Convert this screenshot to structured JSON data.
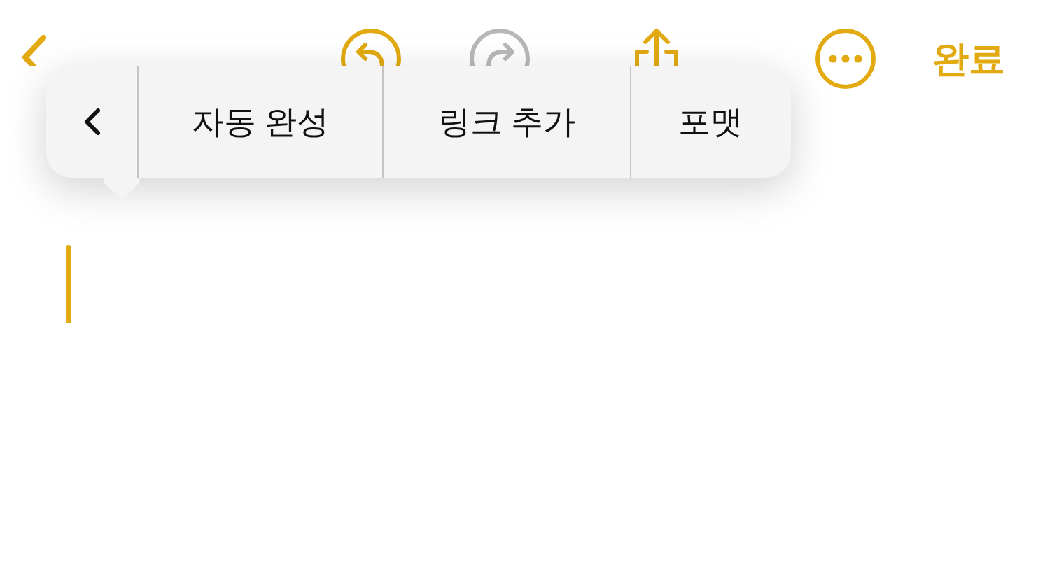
{
  "nav": {
    "undo": {
      "disabled": false
    },
    "redo": {
      "disabled": true
    },
    "done": "완료"
  },
  "edit_menu": {
    "items": [
      "자동 완성",
      "링크 추가",
      "포맷"
    ]
  }
}
